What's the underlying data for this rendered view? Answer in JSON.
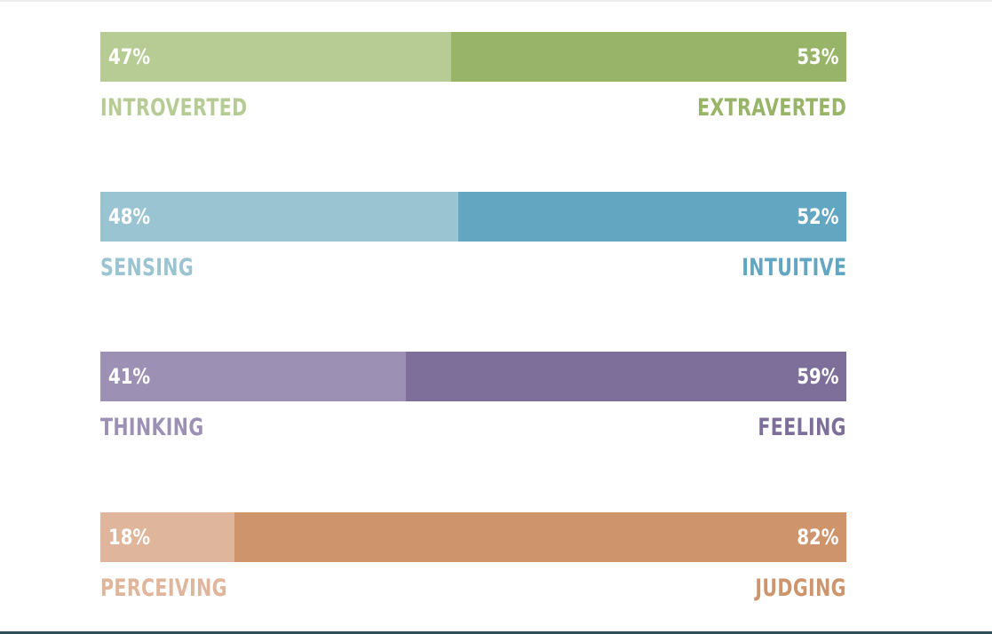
{
  "chart_data": {
    "type": "bar",
    "orientation": "horizontal-stacked",
    "rows": [
      {
        "left_label": "INTROVERTED",
        "left_value": 47,
        "left_text": "47%",
        "right_label": "EXTRAVERTED",
        "right_value": 53,
        "right_text": "53%",
        "left_color": "#b7cc94",
        "right_color": "#98b468"
      },
      {
        "left_label": "SENSING",
        "left_value": 48,
        "left_text": "48%",
        "right_label": "INTUITIVE",
        "right_value": 52,
        "right_text": "52%",
        "left_color": "#9bc4d3",
        "right_color": "#63a6c1"
      },
      {
        "left_label": "THINKING",
        "left_value": 41,
        "left_text": "41%",
        "right_label": "FEELING",
        "right_value": 59,
        "right_text": "59%",
        "left_color": "#9c91b4",
        "right_color": "#7d6f99"
      },
      {
        "left_label": "PERCEIVING",
        "left_value": 18,
        "left_text": "18%",
        "right_label": "JUDGING",
        "right_value": 82,
        "right_text": "82%",
        "left_color": "#dfb59b",
        "right_color": "#ce956d"
      }
    ],
    "xlim": [
      0,
      100
    ],
    "grid": false,
    "legend": "none"
  },
  "colors": {
    "bottom_rule": "#2d4f57",
    "top_rule": "#ececec",
    "percent_text": "#ffffff"
  }
}
